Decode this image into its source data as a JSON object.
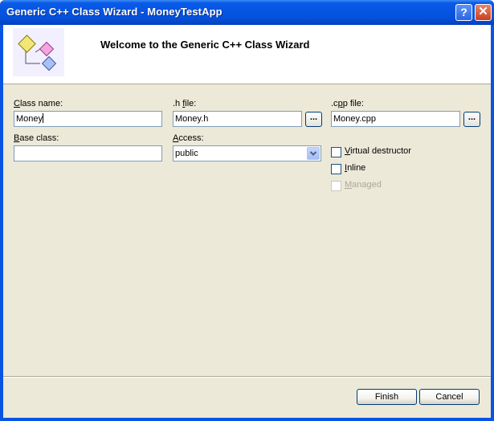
{
  "window": {
    "title": "Generic C++ Class Wizard - MoneyTestApp"
  },
  "titlebar": {
    "help_label": "?",
    "close_label": "✕"
  },
  "header": {
    "title": "Welcome to the Generic C++ Class Wizard",
    "icon": "class-diagram-icon"
  },
  "form": {
    "class_name": {
      "label_accel": "C",
      "label_rest": "lass name:",
      "value": "Money"
    },
    "h_file": {
      "label_pre": ".h ",
      "label_accel": "f",
      "label_rest": "ile:",
      "value": "Money.h",
      "browse_label": "..."
    },
    "cpp_file": {
      "label_pre": ".c",
      "label_accel": "p",
      "label_rest": "p file:",
      "value": "Money.cpp",
      "browse_label": "..."
    },
    "base_class": {
      "label_accel": "B",
      "label_rest": "ase class:",
      "value": ""
    },
    "access": {
      "label_accel": "A",
      "label_rest": "ccess:",
      "selected": "public"
    },
    "virtual_destructor": {
      "label_accel": "V",
      "label_rest": "irtual destructor",
      "checked": false
    },
    "inline": {
      "label_accel": "I",
      "label_rest": "nline",
      "checked": false
    },
    "managed": {
      "label_accel": "M",
      "label_rest": "anaged",
      "checked": false,
      "disabled": true
    }
  },
  "footer": {
    "finish_label": "Finish",
    "cancel_label": "Cancel"
  }
}
